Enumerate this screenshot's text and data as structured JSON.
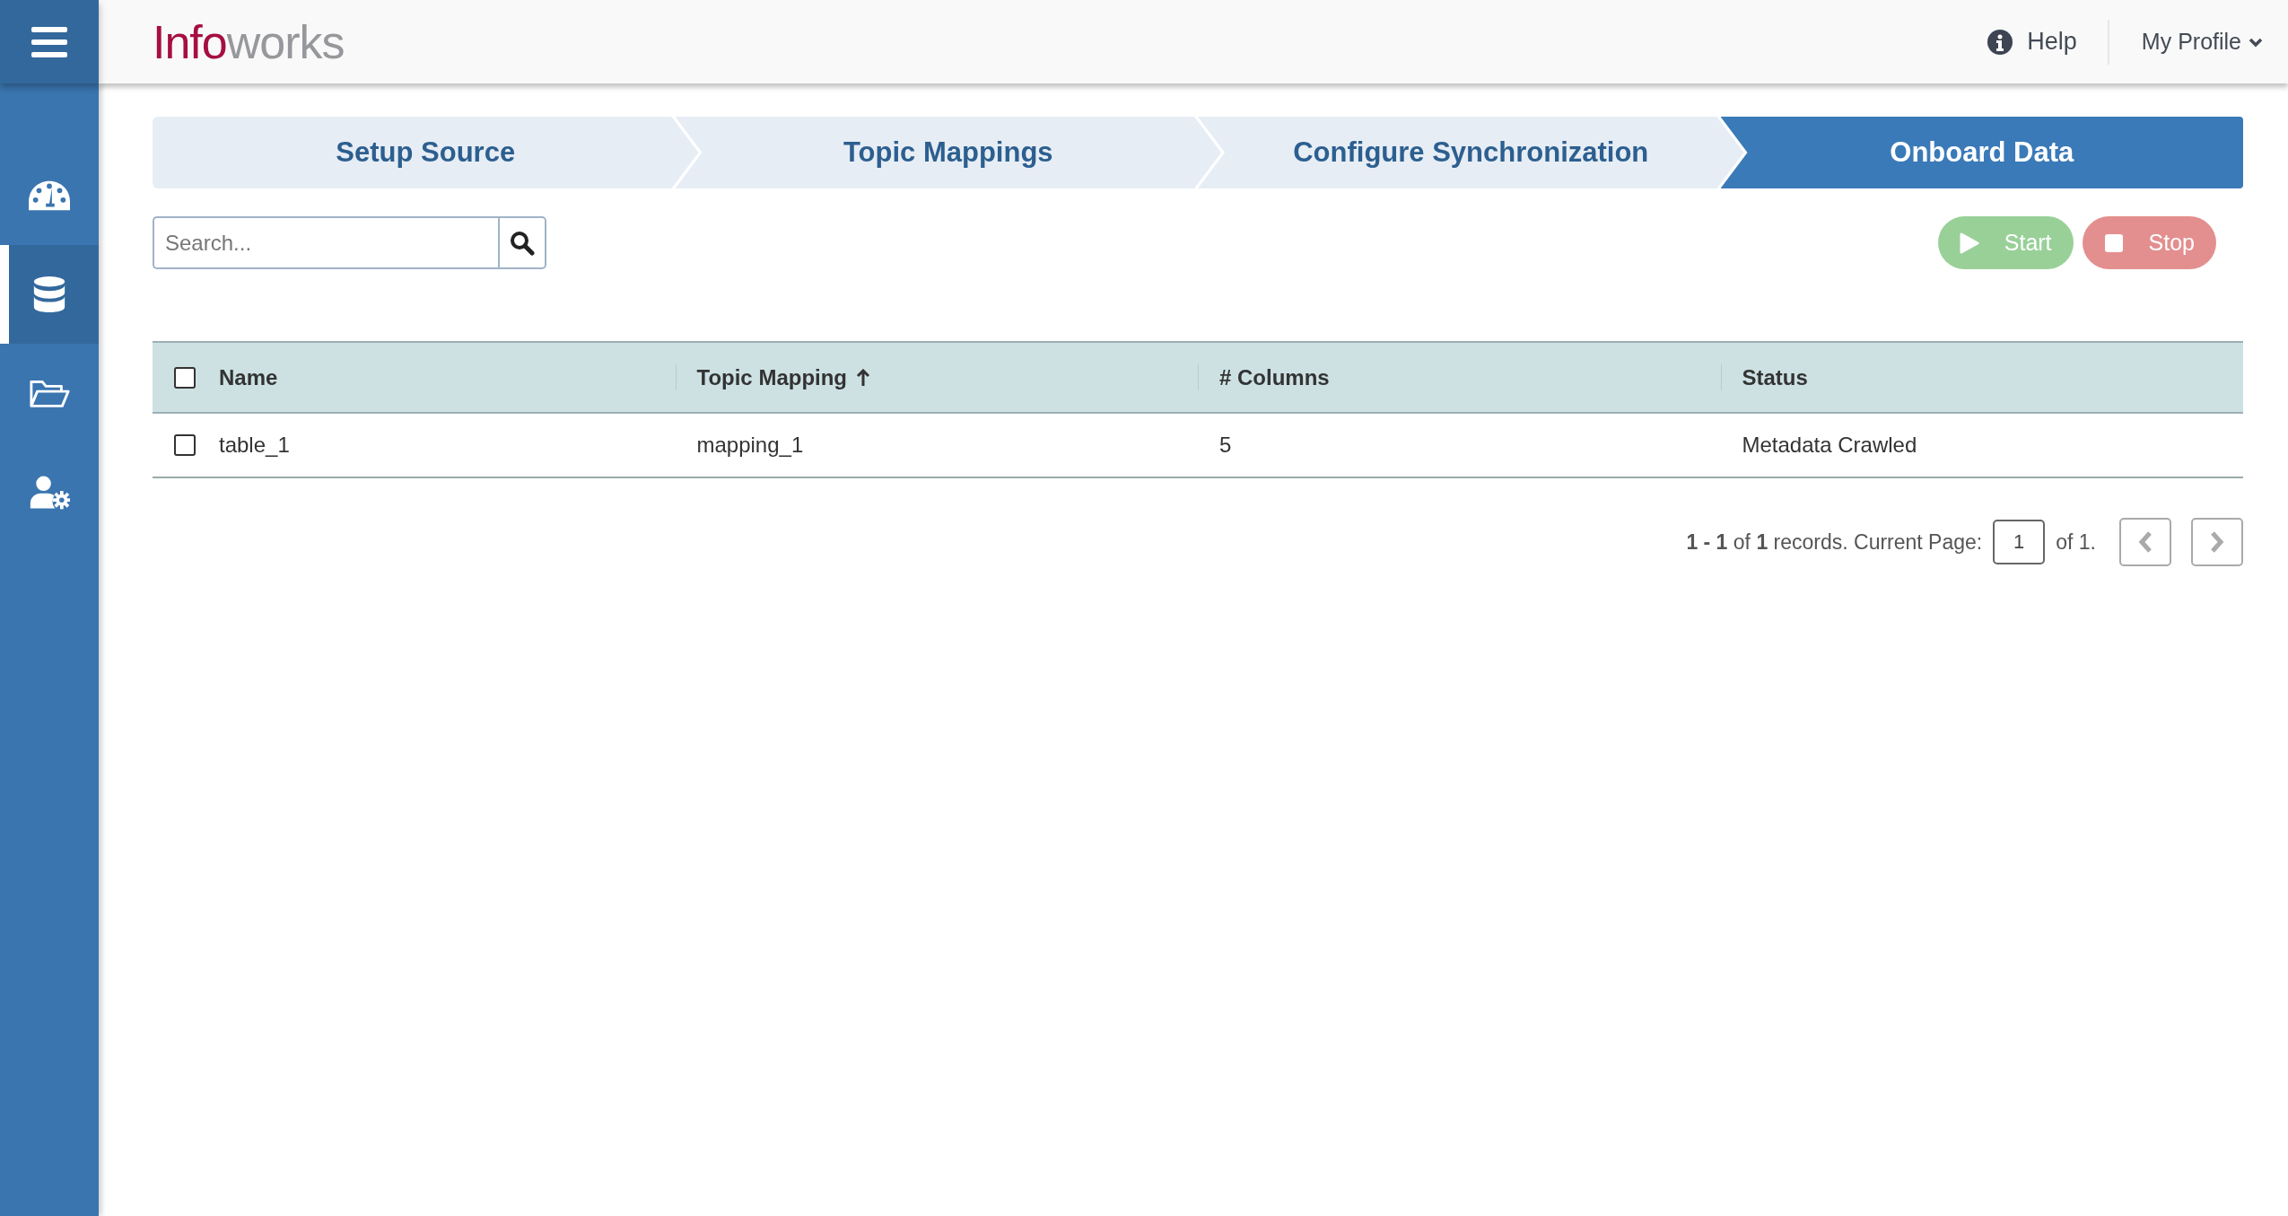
{
  "header": {
    "logo": {
      "accent": "Info",
      "rest": "works"
    },
    "help": "Help",
    "profile": "My Profile"
  },
  "sidebar": {
    "items": [
      {
        "kind": "dashboard",
        "selected": false
      },
      {
        "kind": "database",
        "selected": true
      },
      {
        "kind": "folder",
        "selected": false
      },
      {
        "kind": "user-settings",
        "selected": false
      }
    ]
  },
  "steps": [
    {
      "label": "Setup Source",
      "selected": false
    },
    {
      "label": "Topic Mappings",
      "selected": false
    },
    {
      "label": "Configure Synchronization",
      "selected": false
    },
    {
      "label": "Onboard Data",
      "selected": true
    }
  ],
  "search": {
    "placeholder": "Search..."
  },
  "actions": [
    {
      "kind": "start",
      "label": "Start",
      "disabled": true
    },
    {
      "kind": "stop",
      "label": "Stop",
      "disabled": true
    }
  ],
  "table": {
    "select_all": {
      "checked": false
    },
    "columns": [
      {
        "label": "Name",
        "sorted": false
      },
      {
        "label": "Topic Mapping",
        "sorted": true
      },
      {
        "label": "# Columns",
        "sorted": false
      },
      {
        "label": "Status",
        "sorted": false
      }
    ],
    "rows": [
      {
        "checked": false,
        "cells": [
          "table_1",
          "mapping_1",
          "5",
          "Metadata Crawled"
        ]
      }
    ]
  },
  "pagination": {
    "summary": "**1 - 1** of **1** records. Current Page:",
    "page": "1",
    "total": "of 1.",
    "prev_disabled": true,
    "next_disabled": true
  }
}
